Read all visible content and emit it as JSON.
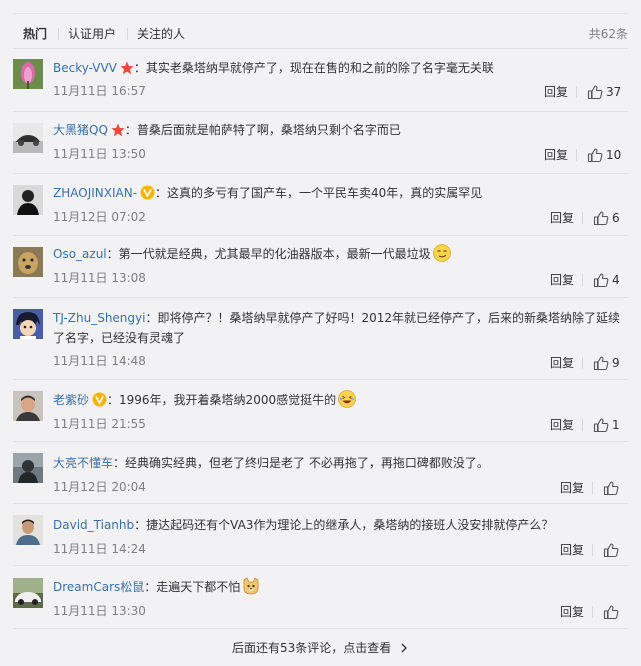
{
  "filter": {
    "tabs": [
      "热门",
      "认证用户",
      "关注的人"
    ],
    "active": "热门",
    "total": "共62条"
  },
  "comments": [
    {
      "user": "Becky-VVV",
      "badge": "star",
      "text": "：其实老桑塔纳早就停产了，现在在售的和之前的除了名字毫无关联",
      "time": "11月11日 16:57",
      "reply": "回复",
      "likes": "37",
      "emoji": ""
    },
    {
      "user": "大黑猪QQ",
      "badge": "star",
      "text": "：普桑后面就是帕萨特了啊，桑塔纳只剩个名字而已",
      "time": "11月11日 13:50",
      "reply": "回复",
      "likes": "10",
      "emoji": ""
    },
    {
      "user": "ZHAOJINXIAN-",
      "badge": "vip",
      "text": "：这真的多亏有了国产车，一个平民车卖40年，真的实属罕见",
      "time": "11月12日 07:02",
      "reply": "回复",
      "likes": "6",
      "emoji": ""
    },
    {
      "user": "Oso_azul",
      "badge": "",
      "text": "：第一代就是经典，尤其最早的化油器版本，最新一代最垃圾",
      "time": "11月11日 13:08",
      "reply": "回复",
      "likes": "4",
      "emoji": "smirk-emoji"
    },
    {
      "user": "TJ-Zhu_Shengyi",
      "badge": "",
      "text": "：即将停产？！桑塔纳早就停产了好吗！2012年就已经停产了，后来的新桑塔纳除了延续了名字，已经没有灵魂了",
      "time": "11月11日 14:48",
      "reply": "回复",
      "likes": "9",
      "emoji": ""
    },
    {
      "user": "老紫砂",
      "badge": "vip",
      "text": "：1996年，我开着桑塔纳2000感觉挺牛的",
      "time": "11月11日 21:55",
      "reply": "回复",
      "likes": "1",
      "emoji": "laugh-emoji"
    },
    {
      "user": "大亮不懂车",
      "badge": "",
      "text": "：经典确实经典，但老了终归是老了 不必再拖了，再拖口碑都败没了。",
      "time": "11月12日 20:04",
      "reply": "回复",
      "likes": "",
      "emoji": ""
    },
    {
      "user": "David_Tianhb",
      "badge": "",
      "text": "：捷达起码还有个VA3作为理论上的继承人，桑塔纳的接班人没安排就停产么？",
      "time": "11月11日 14:24",
      "reply": "回复",
      "likes": "",
      "emoji": ""
    },
    {
      "user": "DreamCars松鼠",
      "badge": "",
      "text": "：走遍天下都不怕",
      "time": "11月11日 13:30",
      "reply": "回复",
      "likes": "",
      "emoji": "doge-emoji"
    }
  ],
  "more": "后面还有53条评论，点击查看",
  "colors": {
    "username": "#3a6fa8",
    "accent": "#eb7350",
    "time": "#808080",
    "background": "#f2f2f5",
    "vip": "#f8b500",
    "star": "#f14b3b"
  },
  "icons": {
    "like": "thumbs-up-icon",
    "more": "chevron-right-icon",
    "star": "star-badge-icon",
    "vip": "vip-badge-icon"
  }
}
